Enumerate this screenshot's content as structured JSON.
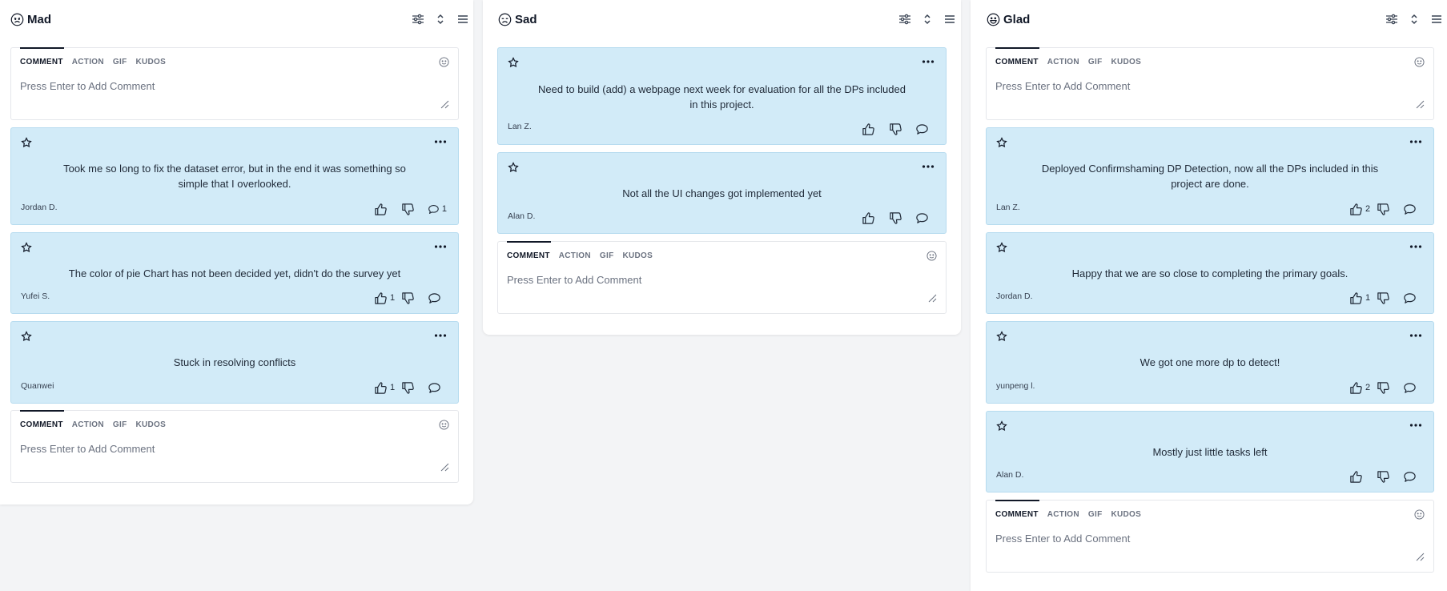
{
  "columns": {
    "mad": {
      "title": "Mad",
      "icon": "angry-face-icon",
      "composer_top": {
        "tabs": [
          "COMMENT",
          "ACTION",
          "GIF",
          "KUDOS"
        ],
        "placeholder": "Press Enter to Add Comment"
      },
      "cards": [
        {
          "text": "Took me so long to fix the dataset error, but in the end it was something so simple that I overlooked.",
          "author": "Jordan D.",
          "up": "",
          "down": "",
          "comments": "1"
        },
        {
          "text": "The color of pie Chart has not been decided yet, didn't do the survey yet",
          "author": "Yufei S.",
          "up": "1",
          "down": "",
          "comments": ""
        },
        {
          "text": "Stuck in resolving conflicts",
          "author": "Quanwei",
          "up": "1",
          "down": "",
          "comments": ""
        }
      ],
      "composer_bottom": {
        "tabs": [
          "COMMENT",
          "ACTION",
          "GIF",
          "KUDOS"
        ],
        "placeholder": "Press Enter to Add Comment"
      }
    },
    "sad": {
      "title": "Sad",
      "icon": "sad-face-icon",
      "cards": [
        {
          "text": "Need to build (add) a webpage next week for evaluation for all the DPs included in this project.",
          "author": "Lan Z.",
          "up": "",
          "down": "",
          "comments": ""
        },
        {
          "text": "Not all the UI changes got implemented yet",
          "author": "Alan D.",
          "up": "",
          "down": "",
          "comments": ""
        }
      ],
      "composer_bottom": {
        "tabs": [
          "COMMENT",
          "ACTION",
          "GIF",
          "KUDOS"
        ],
        "placeholder": "Press Enter to Add Comment"
      }
    },
    "glad": {
      "title": "Glad",
      "icon": "happy-face-icon",
      "composer_top": {
        "tabs": [
          "COMMENT",
          "ACTION",
          "GIF",
          "KUDOS"
        ],
        "placeholder": "Press Enter to Add Comment"
      },
      "cards": [
        {
          "text": "Deployed Confirmshaming DP Detection, now all the DPs included in this project are done.",
          "author": "Lan Z.",
          "up": "2",
          "down": "",
          "comments": ""
        },
        {
          "text": "Happy that we are so close to completing the primary goals.",
          "author": "Jordan D.",
          "up": "1",
          "down": "",
          "comments": ""
        },
        {
          "text": "We got one more dp to detect!",
          "author": "yunpeng l.",
          "up": "2",
          "down": "",
          "comments": ""
        },
        {
          "text": "Mostly just little tasks left",
          "author": "Alan D.",
          "up": "",
          "down": "",
          "comments": ""
        }
      ],
      "composer_bottom": {
        "tabs": [
          "COMMENT",
          "ACTION",
          "GIF",
          "KUDOS"
        ],
        "placeholder": "Press Enter to Add Comment"
      }
    }
  },
  "colors": {
    "card_background": "#d2ebf8",
    "page_background": "#f3f4f6",
    "column_background": "#ffffff"
  }
}
